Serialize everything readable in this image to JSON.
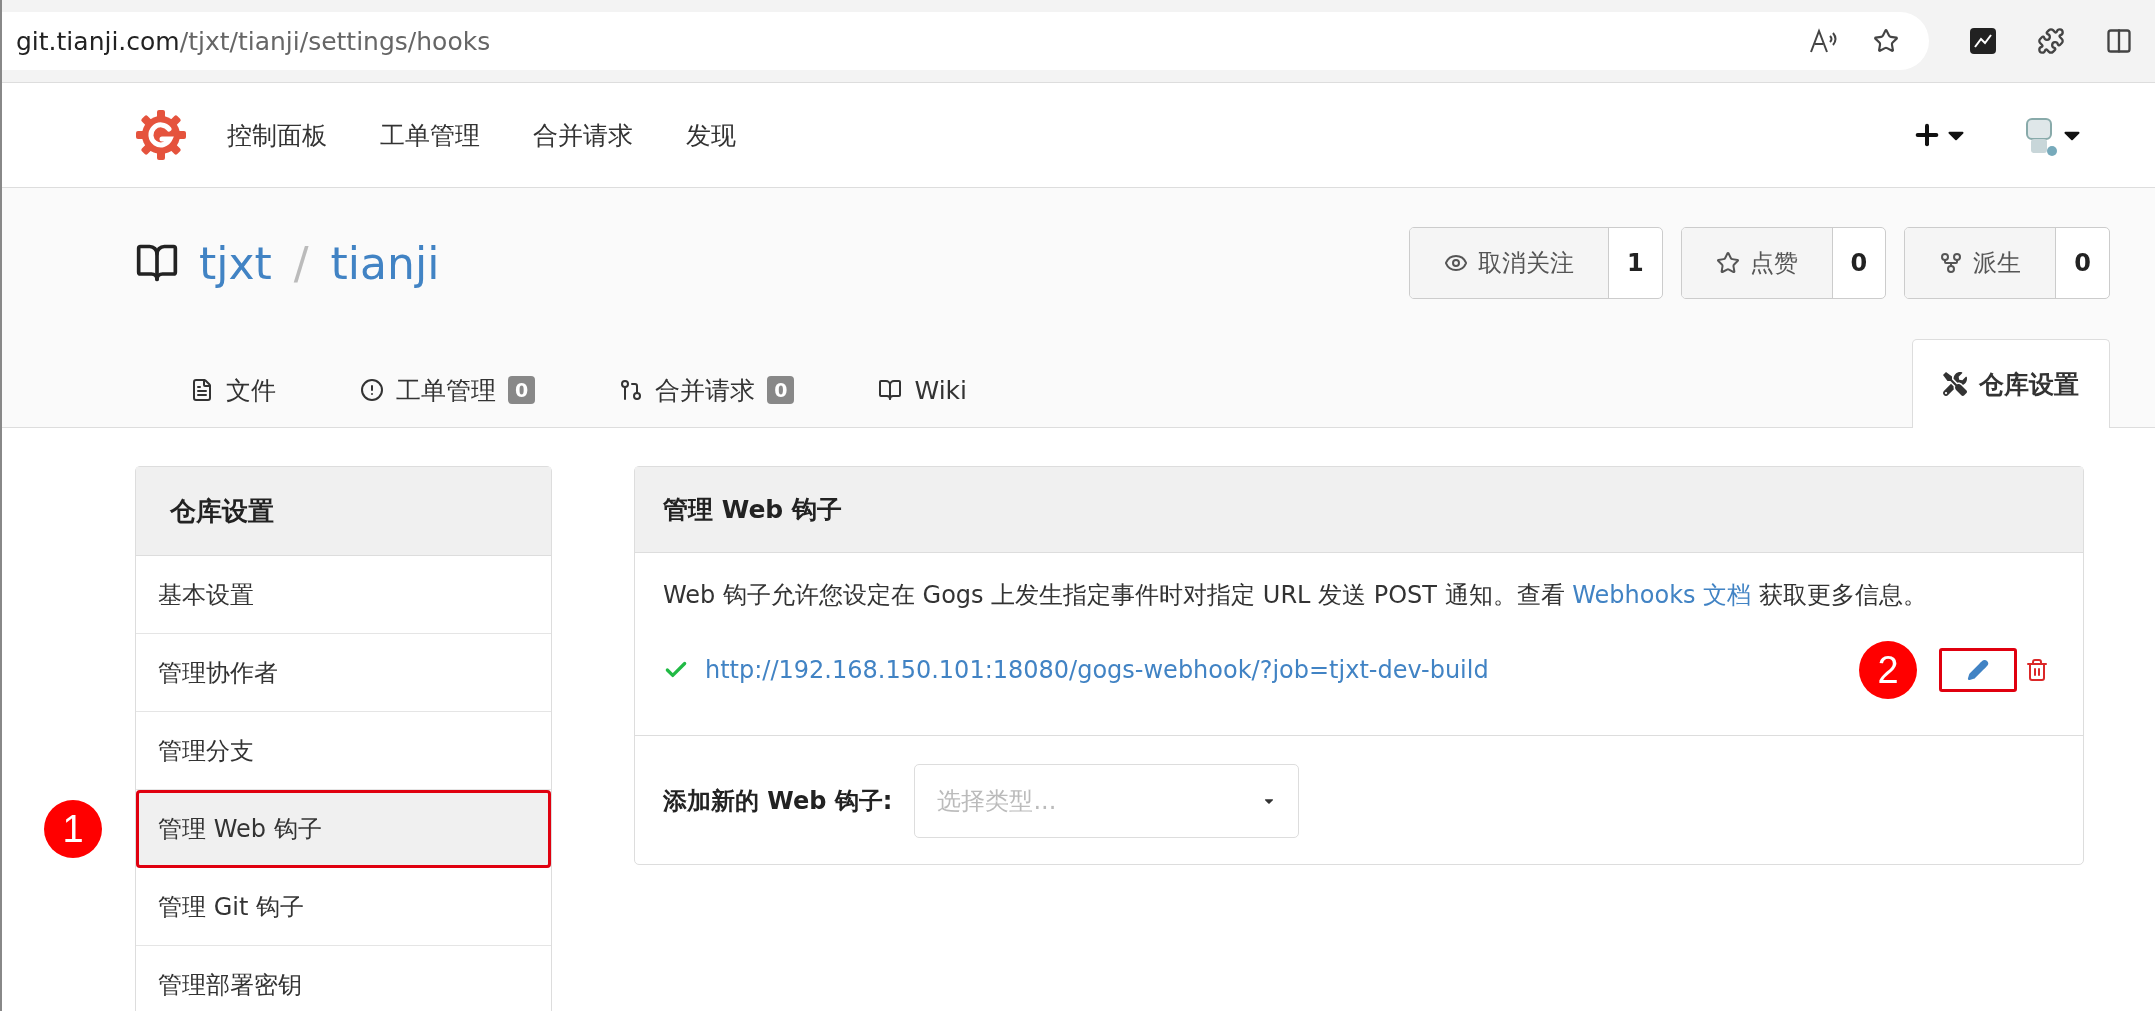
{
  "browser": {
    "url_host": "git.tianji.com",
    "url_path": "/tjxt/tianji/settings/hooks"
  },
  "nav": {
    "items": [
      "控制面板",
      "工单管理",
      "合并请求",
      "发现"
    ]
  },
  "repo": {
    "owner": "tjxt",
    "separator": "/",
    "name": "tianji"
  },
  "actions": [
    {
      "kind": "watch",
      "label": "取消关注",
      "count": "1"
    },
    {
      "kind": "star",
      "label": "点赞",
      "count": "0"
    },
    {
      "kind": "fork",
      "label": "派生",
      "count": "0"
    }
  ],
  "tabs": [
    {
      "kind": "file",
      "label": "文件",
      "selected": false
    },
    {
      "kind": "issue",
      "label": "工单管理",
      "count": "0",
      "selected": false
    },
    {
      "kind": "pull",
      "label": "合并请求",
      "count": "0",
      "selected": false
    },
    {
      "kind": "wiki",
      "label": "Wiki",
      "selected": false
    },
    {
      "kind": "settings",
      "label": "仓库设置",
      "selected": true
    }
  ],
  "sidebar": {
    "title": "仓库设置",
    "items": [
      {
        "label": "基本设置",
        "selected": false,
        "highlighted": false
      },
      {
        "label": "管理协作者",
        "selected": false,
        "highlighted": false
      },
      {
        "label": "管理分支",
        "selected": false,
        "highlighted": false
      },
      {
        "label": "管理 Web 钩子",
        "selected": true,
        "highlighted": true,
        "marker": "1"
      },
      {
        "label": "管理 Git 钩子",
        "selected": false,
        "highlighted": false
      },
      {
        "label": "管理部署密钥",
        "selected": false,
        "highlighted": false
      }
    ]
  },
  "panel": {
    "title": "管理 Web 钩子",
    "description": "Web 钩子允许您设定在 Gogs 上发生指定事件时对指定 URL 发送 POST 通知。查看",
    "link": "Webhooks 文档",
    "description_end": "获取更多信息。",
    "hooks": [
      {
        "url": "http://192.168.150.101:18080/gogs-webhook/?job=tjxt-dev-build",
        "active": true,
        "edit_highlighted": true,
        "marker": "2"
      }
    ],
    "add": {
      "label": "添加新的 Web 钩子:",
      "placeholder": "选择类型..."
    }
  }
}
